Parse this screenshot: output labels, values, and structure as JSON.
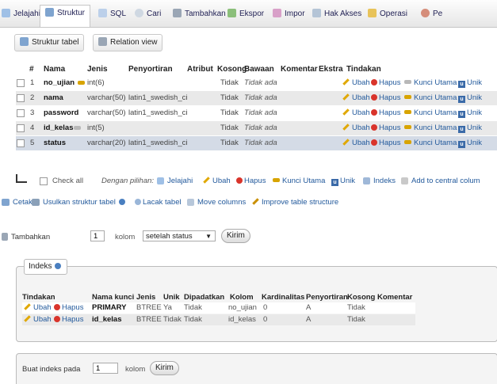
{
  "tabs": [
    {
      "label": "Jelajahi",
      "icon": "browse-icon"
    },
    {
      "label": "Struktur",
      "icon": "structure-icon"
    },
    {
      "label": "SQL",
      "icon": "sql-icon"
    },
    {
      "label": "Cari",
      "icon": "search-icon"
    },
    {
      "label": "Tambahkan",
      "icon": "insert-icon"
    },
    {
      "label": "Ekspor",
      "icon": "export-icon"
    },
    {
      "label": "Impor",
      "icon": "import-icon"
    },
    {
      "label": "Hak Akses",
      "icon": "privileges-icon"
    },
    {
      "label": "Operasi",
      "icon": "operations-icon"
    },
    {
      "label": "Pe",
      "icon": "tracking-icon"
    }
  ],
  "subtabs": {
    "structure": "Struktur tabel",
    "relation": "Relation view"
  },
  "columns_header": {
    "num": "#",
    "name": "Nama",
    "type": "Jenis",
    "collation": "Penyortiran",
    "attributes": "Atribut",
    "null": "Kosong",
    "default": "Bawaan",
    "comments": "Komentar",
    "extra": "Ekstra",
    "action": "Tindakan"
  },
  "columns": [
    {
      "num": "1",
      "name": "no_ujian",
      "type": "int(6)",
      "collation": "",
      "null": "Tidak",
      "default": "Tidak ada",
      "key": true
    },
    {
      "num": "2",
      "name": "nama",
      "type": "varchar(50)",
      "collation": "latin1_swedish_ci",
      "null": "Tidak",
      "default": "Tidak ada",
      "key": false
    },
    {
      "num": "3",
      "name": "password",
      "type": "varchar(50)",
      "collation": "latin1_swedish_ci",
      "null": "Tidak",
      "default": "Tidak ada",
      "key": false
    },
    {
      "num": "4",
      "name": "id_kelas",
      "type": "int(5)",
      "collation": "",
      "null": "Tidak",
      "default": "Tidak ada",
      "key": true
    },
    {
      "num": "5",
      "name": "status",
      "type": "varchar(20)",
      "collation": "latin1_swedish_ci",
      "null": "Tidak",
      "default": "Tidak ada",
      "key": false
    }
  ],
  "row_actions": {
    "edit": "Ubah",
    "drop": "Hapus",
    "primary": "Kunci Utama",
    "unique": "Unik"
  },
  "bulk": {
    "check_all": "Check all",
    "with_selected": "Dengan pilihan:",
    "browse": "Jelajahi",
    "edit": "Ubah",
    "drop": "Hapus",
    "primary": "Kunci Utama",
    "unique": "Unik",
    "index": "Indeks",
    "central": "Add to central colum"
  },
  "links": {
    "print": "Cetak",
    "propose": "Usulkan struktur tabel",
    "track": "Lacak tabel",
    "move": "Move columns",
    "improve": "Improve table structure"
  },
  "add_column": {
    "label": "Tambahkan",
    "count": "1",
    "unit": "kolom",
    "position": "setelah status",
    "submit": "Kirim"
  },
  "indexes": {
    "legend": "Indeks",
    "header": {
      "action": "Tindakan",
      "keyname": "Nama kunci",
      "type": "Jenis",
      "unique": "Unik",
      "packed": "Dipadatkan",
      "column": "Kolom",
      "cardinality": "Kardinalitas",
      "collation": "Penyortiran",
      "null": "Kosong",
      "comment": "Komentar"
    },
    "rows": [
      {
        "edit": "Ubah",
        "drop": "Hapus",
        "keyname": "PRIMARY",
        "type": "BTREE",
        "unique": "Ya",
        "packed": "Tidak",
        "column": "no_ujian",
        "cardinality": "0",
        "collation": "A",
        "null": "Tidak"
      },
      {
        "edit": "Ubah",
        "drop": "Hapus",
        "keyname": "id_kelas",
        "type": "BTREE",
        "unique": "Tidak",
        "packed": "Tidak",
        "column": "id_kelas",
        "cardinality": "0",
        "collation": "A",
        "null": "Tidak"
      }
    ]
  },
  "create_index": {
    "label": "Buat indeks pada",
    "count": "1",
    "unit": "kolom",
    "submit": "Kirim"
  },
  "colors": {
    "link": "#235a9c",
    "row_alt": "#e9e9e9",
    "row_selected": "#d4dbe6",
    "drop_red": "#d9342b",
    "key_yellow": "#d8a400"
  }
}
